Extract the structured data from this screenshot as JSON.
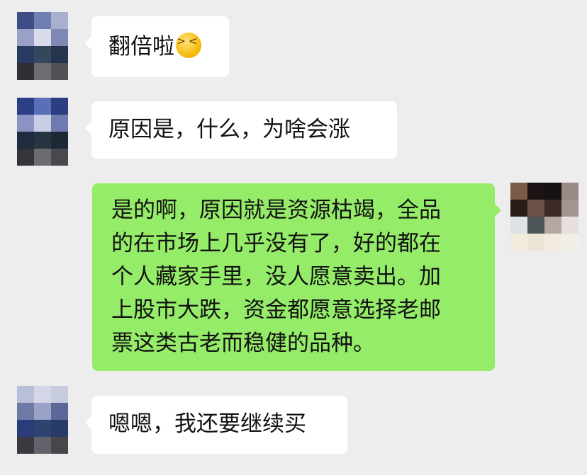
{
  "chat": {
    "messages": [
      {
        "sender": "other",
        "text": "翻倍啦",
        "emoji": "grinning-squinting-face"
      },
      {
        "sender": "other",
        "text": "原因是，什么，为啥会涨"
      },
      {
        "sender": "self",
        "lines": [
          "是的啊，原因就是资源枯竭，全品",
          "的在市场上几乎没有了，好的都在",
          "个人藏家手里，没人愿意卖出。加",
          "上股市大跌，资金都愿意选择老邮",
          "票这类古老而稳健的品种。"
        ]
      },
      {
        "sender": "other",
        "text": "嗯嗯，我还要继续买"
      }
    ]
  },
  "colors": {
    "background": "#ededed",
    "incoming_bubble": "#ffffff",
    "outgoing_bubble": "#95ec69",
    "text": "#111111"
  }
}
